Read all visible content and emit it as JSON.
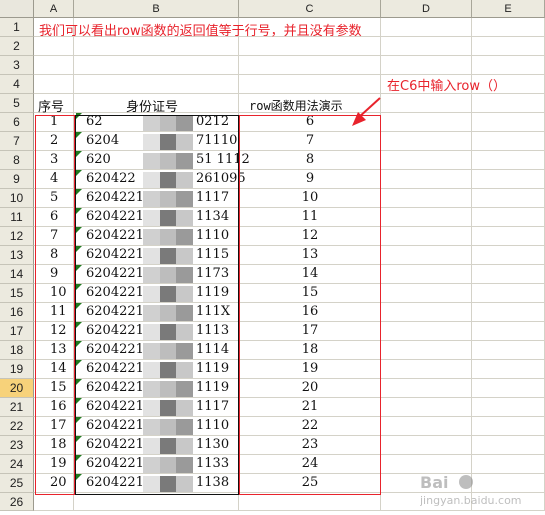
{
  "columns": [
    "A",
    "B",
    "C",
    "D",
    "E"
  ],
  "rows": [
    "1",
    "2",
    "3",
    "4",
    "5",
    "6",
    "7",
    "8",
    "9",
    "10",
    "11",
    "12",
    "13",
    "14",
    "15",
    "16",
    "17",
    "18",
    "19",
    "20",
    "21",
    "22",
    "23",
    "24",
    "25",
    "26"
  ],
  "highlighted_row": "20",
  "note_row1": "我们可以看出row函数的返回值等于行号，并且没有参数",
  "callout": "在C6中输入row（）",
  "headers": {
    "seq": "序号",
    "id": "身份证号",
    "demo": "row函数用法演示"
  },
  "table": [
    {
      "seq": "1",
      "id": "62",
      "id_end": "0212",
      "row_val": "6"
    },
    {
      "seq": "2",
      "id": "6204",
      "id_end": "71110",
      "row_val": "7"
    },
    {
      "seq": "3",
      "id": "620",
      "id_end": "51 1112",
      "row_val": "8"
    },
    {
      "seq": "4",
      "id": "620422",
      "id_end": "261095",
      "row_val": "9"
    },
    {
      "seq": "5",
      "id": "6204221",
      "id_end": "1117",
      "row_val": "10"
    },
    {
      "seq": "6",
      "id": "6204221",
      "id_end": "1134",
      "row_val": "11"
    },
    {
      "seq": "7",
      "id": "6204221",
      "id_end": "1110",
      "row_val": "12"
    },
    {
      "seq": "8",
      "id": "6204221",
      "id_end": "1115",
      "row_val": "13"
    },
    {
      "seq": "9",
      "id": "6204221",
      "id_end": "1173",
      "row_val": "14"
    },
    {
      "seq": "10",
      "id": "6204221",
      "id_end": "1119",
      "row_val": "15"
    },
    {
      "seq": "11",
      "id": "6204221",
      "id_end": "111X",
      "row_val": "16"
    },
    {
      "seq": "12",
      "id": "6204221",
      "id_end": "1113",
      "row_val": "17"
    },
    {
      "seq": "13",
      "id": "6204221",
      "id_end": "1114",
      "row_val": "18"
    },
    {
      "seq": "14",
      "id": "6204221",
      "id_end": "1119",
      "row_val": "19"
    },
    {
      "seq": "15",
      "id": "6204221",
      "id_end": "1119",
      "row_val": "20"
    },
    {
      "seq": "16",
      "id": "6204221",
      "id_end": "1117",
      "row_val": "21"
    },
    {
      "seq": "17",
      "id": "6204221",
      "id_end": "1110",
      "row_val": "22"
    },
    {
      "seq": "18",
      "id": "6204221",
      "id_end": "1130",
      "row_val": "23"
    },
    {
      "seq": "19",
      "id": "6204221",
      "id_end": "1133",
      "row_val": "24"
    },
    {
      "seq": "20",
      "id": "6204221",
      "id_end": "1138",
      "row_val": "25"
    }
  ],
  "colors": {
    "accent_red": "#e8232c",
    "header_bg": "#eceadf",
    "row_highlight": "#f7d27a"
  },
  "watermark": "Baidu经验"
}
